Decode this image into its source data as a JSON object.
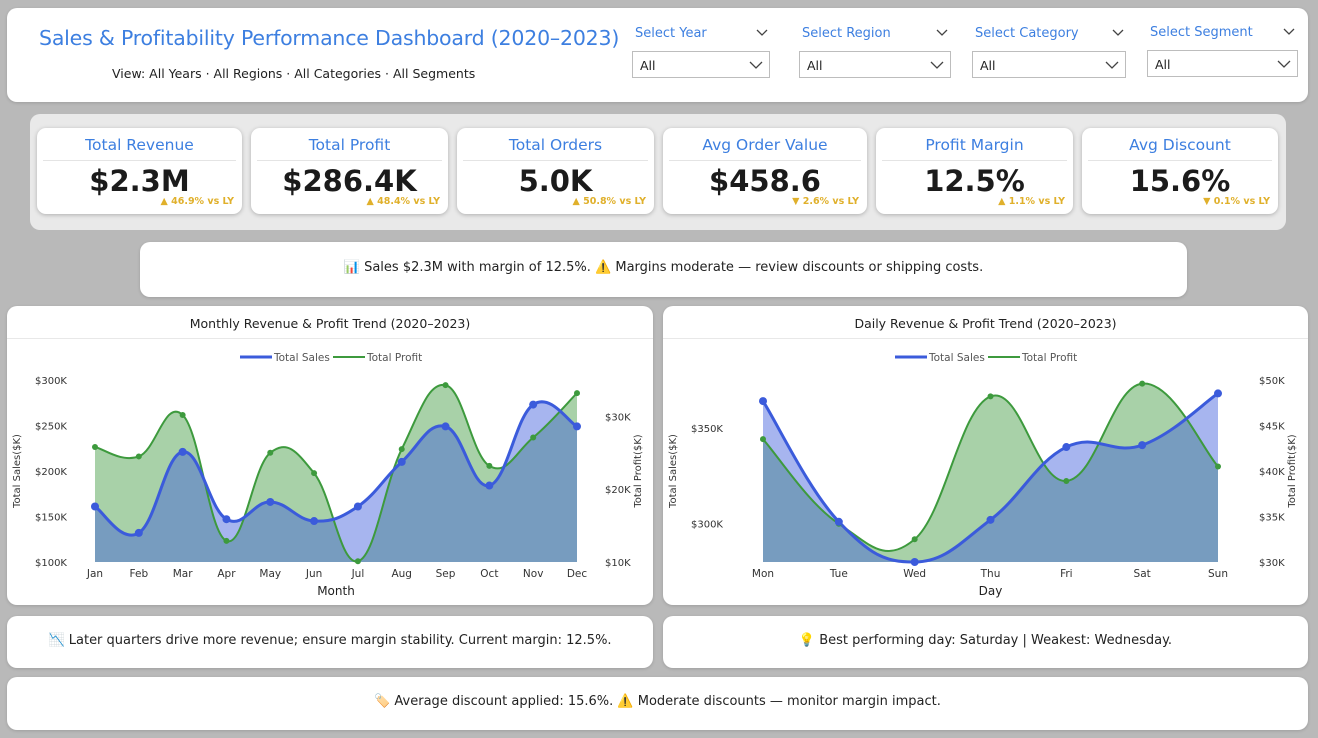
{
  "header": {
    "title": "Sales & Profitability Performance Dashboard (2020–2023)",
    "subtitle": "View: All Years · All Regions · All Categories · All Segments"
  },
  "filters": [
    {
      "label": "Select Year",
      "value": "All"
    },
    {
      "label": "Select Region",
      "value": "All"
    },
    {
      "label": "Select Category",
      "value": "All"
    },
    {
      "label": "Select Segment",
      "value": "All"
    }
  ],
  "kpis": [
    {
      "title": "Total Revenue",
      "value": "$2.3M",
      "delta": "▲ 46.9% vs LY"
    },
    {
      "title": "Total Profit",
      "value": "$286.4K",
      "delta": "▲ 48.4% vs LY"
    },
    {
      "title": "Total Orders",
      "value": "5.0K",
      "delta": "▲ 50.8% vs LY"
    },
    {
      "title": "Avg Order Value",
      "value": "$458.6",
      "delta": "▼ 2.6% vs LY"
    },
    {
      "title": "Profit Margin",
      "value": "12.5%",
      "delta": "▲ 1.1% vs LY"
    },
    {
      "title": "Avg Discount",
      "value": "15.6%",
      "delta": "▼ 0.1% vs LY"
    }
  ],
  "insights": {
    "summary": "📊 Sales $2.3M with margin of 12.5%. ⚠️ Margins moderate — review discounts or shipping costs.",
    "monthly": "📉 Later quarters drive more revenue; ensure margin stability. Current margin: 12.5%.",
    "daily": "💡 Best performing day: Saturday | Weakest: Wednesday.",
    "discount": "🏷️ Average discount applied: 15.6%. ⚠️ Moderate discounts — monitor margin impact."
  },
  "colors": {
    "accent": "#3d7fe0",
    "sales": "#3b5bdb",
    "profit": "#3d9a3d",
    "delta": "#e0b02b"
  },
  "chart_data": [
    {
      "type": "area",
      "title": "Monthly Revenue & Profit Trend (2020–2023)",
      "xlabel": "Month",
      "ylabel": "Total Sales($K)",
      "y2label": "Total Profit($K)",
      "categories": [
        "Jan",
        "Feb",
        "Mar",
        "Apr",
        "May",
        "Jun",
        "Jul",
        "Aug",
        "Sep",
        "Oct",
        "Nov",
        "Dec"
      ],
      "ylim": [
        100,
        300
      ],
      "y2lim": [
        10,
        35
      ],
      "yticks": [
        "$100K",
        "$150K",
        "$200K",
        "$250K",
        "$300K"
      ],
      "y2ticks": [
        "$10K",
        "$20K",
        "$30K"
      ],
      "legend": "top-center",
      "series": [
        {
          "name": "Total Sales",
          "axis": "left",
          "values": [
            161,
            132,
            221,
            147,
            166,
            145,
            161,
            210,
            249,
            184,
            273,
            249
          ]
        },
        {
          "name": "Total Profit",
          "axis": "right",
          "values": [
            25.8,
            24.5,
            30.2,
            12.9,
            25,
            22.2,
            10.1,
            25.5,
            34.3,
            23.2,
            27.1,
            33.2
          ]
        }
      ]
    },
    {
      "type": "area",
      "title": "Daily Revenue & Profit Trend (2020–2023)",
      "xlabel": "Day",
      "ylabel": "Total Sales($K)",
      "y2label": "Total Profit($K)",
      "categories": [
        "Mon",
        "Tue",
        "Wed",
        "Thu",
        "Fri",
        "Sat",
        "Sun"
      ],
      "ylim": [
        280,
        375
      ],
      "y2lim": [
        30,
        50
      ],
      "yticks": [
        "$300K",
        "$350K"
      ],
      "y2ticks": [
        "$30K",
        "$35K",
        "$40K",
        "$45K",
        "$50K"
      ],
      "legend": "top-center",
      "series": [
        {
          "name": "Total Sales",
          "axis": "left",
          "values": [
            364,
            301,
            280,
            302,
            340,
            341,
            368
          ]
        },
        {
          "name": "Total Profit",
          "axis": "right",
          "values": [
            43.5,
            34.2,
            32.5,
            48.2,
            38.9,
            49.6,
            40.5
          ]
        }
      ]
    }
  ]
}
